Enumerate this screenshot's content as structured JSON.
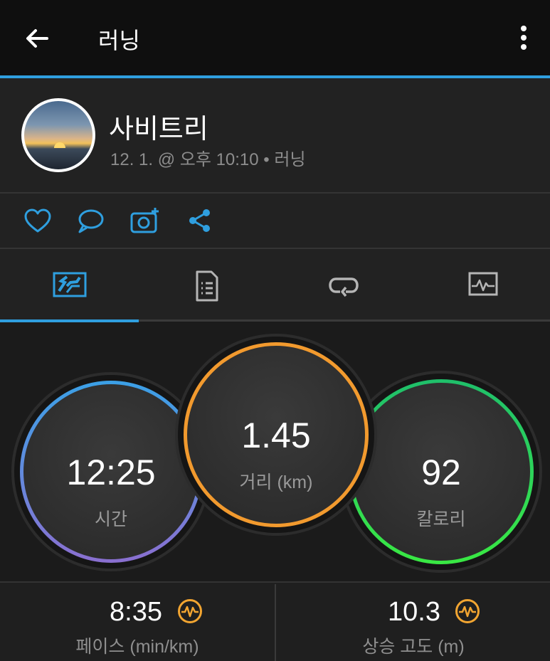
{
  "appbar": {
    "title": "러닝"
  },
  "activity": {
    "user_name": "사비트리",
    "meta": "12. 1. @ 오후 10:10 • 러닝"
  },
  "actions": [
    "heart-icon",
    "comment-icon",
    "add-photo-icon",
    "share-icon"
  ],
  "tabs": [
    "overview-tab-icon",
    "details-tab-icon",
    "laps-tab-icon",
    "charts-tab-icon"
  ],
  "active_tab": 0,
  "stats": {
    "time": {
      "value": "12:25",
      "label": "시간"
    },
    "distance": {
      "value": "1.45",
      "label": "거리 (km)"
    },
    "calories": {
      "value": "92",
      "label": "칼로리"
    }
  },
  "metrics": [
    {
      "value": "8:35",
      "label": "페이스 (min/km)"
    },
    {
      "value": "10.3",
      "label": "상승 고도 (m)"
    }
  ],
  "colors": {
    "accent": "#2f9fdf",
    "time_ring_start": "#3ba0e6",
    "time_ring_end": "#8a6fd0",
    "distance_ring": "#f29a2e",
    "calories_ring_start": "#1fbf6a",
    "calories_ring_end": "#39e843",
    "metric_icon": "#f2a531"
  }
}
